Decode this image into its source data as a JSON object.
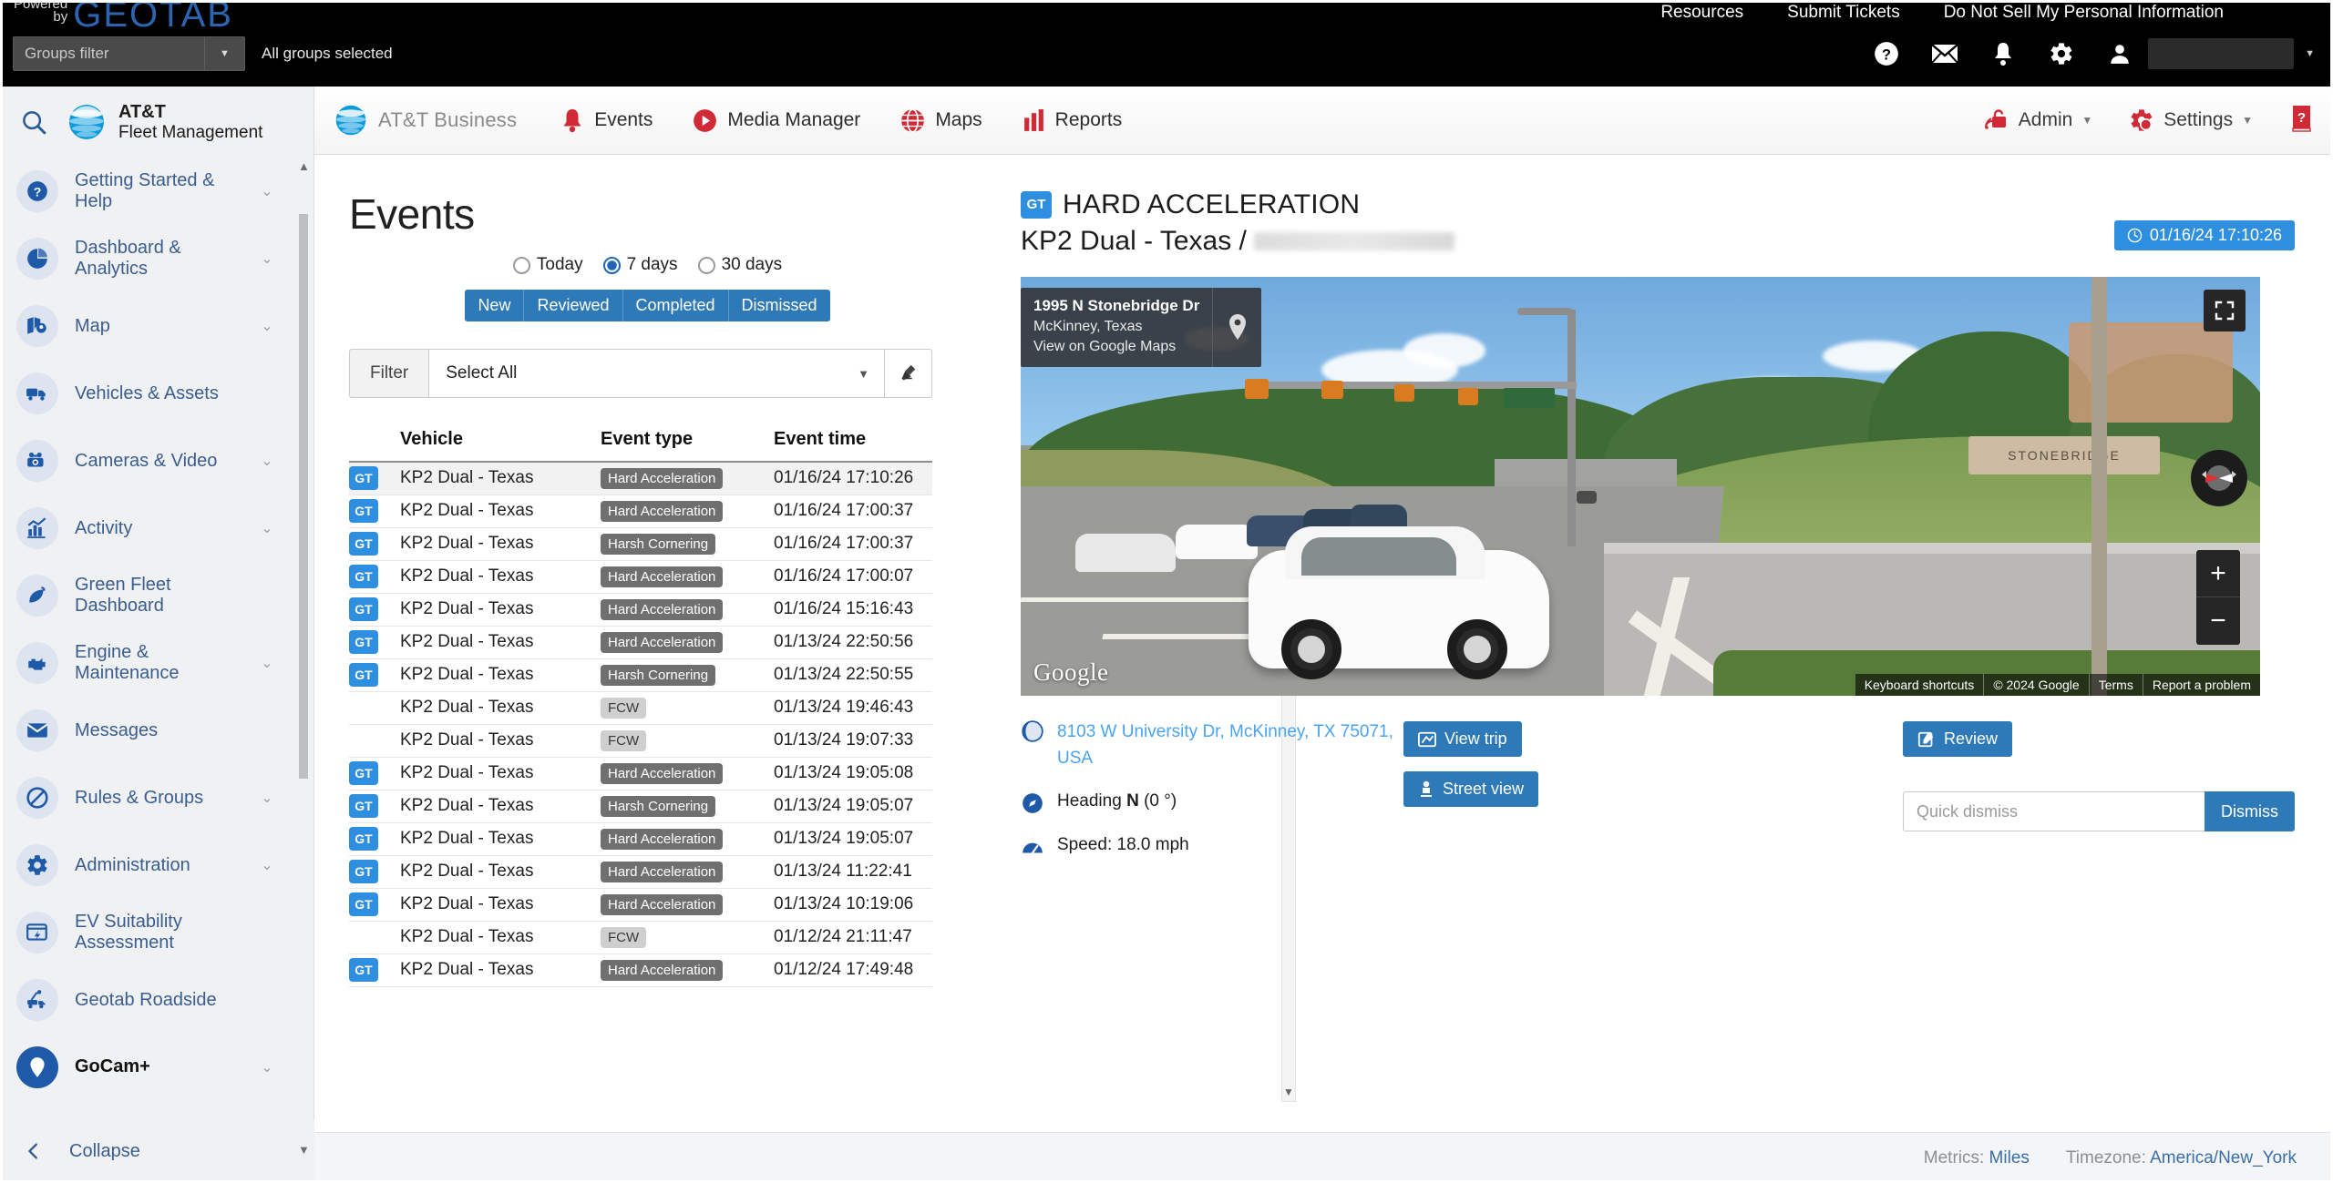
{
  "topbar": {
    "powered_line1": "Powered",
    "powered_line2": "by",
    "brand": "GEOTAB",
    "links": [
      "Resources",
      "Submit Tickets",
      "Do Not Sell My Personal Information"
    ],
    "groups_filter_placeholder": "Groups filter",
    "groups_selected": "All groups selected",
    "icons": [
      "help-icon",
      "mail-icon",
      "bell-icon",
      "gear-icon",
      "user-icon"
    ]
  },
  "sidebar": {
    "brand_line1": "AT&T",
    "brand_line2": "Fleet Management",
    "items": [
      {
        "label": "Getting Started & Help",
        "icon": "question-circle-icon",
        "expandable": true
      },
      {
        "label": "Dashboard & Analytics",
        "icon": "pie-chart-icon",
        "expandable": true
      },
      {
        "label": "Map",
        "icon": "map-pin-icon",
        "expandable": true
      },
      {
        "label": "Vehicles & Assets",
        "icon": "truck-icon",
        "expandable": false
      },
      {
        "label": "Cameras & Video",
        "icon": "dashcam-icon",
        "expandable": true
      },
      {
        "label": "Activity",
        "icon": "bar-chart-icon",
        "expandable": true
      },
      {
        "label": "Green Fleet Dashboard",
        "icon": "leaf-icon",
        "expandable": false
      },
      {
        "label": "Engine & Maintenance",
        "icon": "engine-icon",
        "expandable": true
      },
      {
        "label": "Messages",
        "icon": "envelope-icon",
        "expandable": false
      },
      {
        "label": "Rules & Groups",
        "icon": "no-entry-icon",
        "expandable": true
      },
      {
        "label": "Administration",
        "icon": "gear-icon",
        "expandable": true
      },
      {
        "label": "EV Suitability Assessment",
        "icon": "ev-report-icon",
        "expandable": false
      },
      {
        "label": "Geotab Roadside",
        "icon": "tow-truck-icon",
        "expandable": false
      },
      {
        "label": "GoCam+",
        "icon": "gocam-icon",
        "expandable": true,
        "active": true
      }
    ],
    "collapse_label": "Collapse"
  },
  "appnav": {
    "brand": "AT&T Business",
    "items": [
      {
        "label": "Events",
        "icon": "bell-icon"
      },
      {
        "label": "Media Manager",
        "icon": "play-circle-icon"
      },
      {
        "label": "Maps",
        "icon": "globe-icon"
      },
      {
        "label": "Reports",
        "icon": "bar-chart-icon"
      }
    ],
    "right": [
      {
        "label": "Admin",
        "icon": "admin-lock-icon",
        "caret": true
      },
      {
        "label": "Settings",
        "icon": "gear-wrench-icon",
        "caret": true
      }
    ],
    "help_icon": "help-book-icon"
  },
  "events": {
    "title": "Events",
    "ranges": [
      {
        "label": "Today",
        "selected": false
      },
      {
        "label": "7 days",
        "selected": true
      },
      {
        "label": "30 days",
        "selected": false
      }
    ],
    "status_tabs": [
      "New",
      "Reviewed",
      "Completed",
      "Dismissed"
    ],
    "filter_label": "Filter",
    "filter_value": "Select All",
    "clear_icon": "broom-icon",
    "columns": [
      "",
      "Vehicle",
      "Event type",
      "Event time"
    ],
    "rows": [
      {
        "gt": true,
        "vehicle": "KP2 Dual - Texas",
        "type": "Hard Acceleration",
        "tag": "dark",
        "time": "01/16/24 17:10:26",
        "selected": true
      },
      {
        "gt": true,
        "vehicle": "KP2 Dual - Texas",
        "type": "Hard Acceleration",
        "tag": "dark",
        "time": "01/16/24 17:00:37",
        "selected": false
      },
      {
        "gt": true,
        "vehicle": "KP2 Dual - Texas",
        "type": "Harsh Cornering",
        "tag": "dark",
        "time": "01/16/24 17:00:37",
        "selected": false
      },
      {
        "gt": true,
        "vehicle": "KP2 Dual - Texas",
        "type": "Hard Acceleration",
        "tag": "dark",
        "time": "01/16/24 17:00:07",
        "selected": false
      },
      {
        "gt": true,
        "vehicle": "KP2 Dual - Texas",
        "type": "Hard Acceleration",
        "tag": "dark",
        "time": "01/16/24 15:16:43",
        "selected": false
      },
      {
        "gt": true,
        "vehicle": "KP2 Dual - Texas",
        "type": "Hard Acceleration",
        "tag": "dark",
        "time": "01/13/24 22:50:56",
        "selected": false
      },
      {
        "gt": true,
        "vehicle": "KP2 Dual - Texas",
        "type": "Harsh Cornering",
        "tag": "dark",
        "time": "01/13/24 22:50:55",
        "selected": false
      },
      {
        "gt": false,
        "vehicle": "KP2 Dual - Texas",
        "type": "FCW",
        "tag": "light",
        "time": "01/13/24 19:46:43",
        "selected": false
      },
      {
        "gt": false,
        "vehicle": "KP2 Dual - Texas",
        "type": "FCW",
        "tag": "light",
        "time": "01/13/24 19:07:33",
        "selected": false
      },
      {
        "gt": true,
        "vehicle": "KP2 Dual - Texas",
        "type": "Hard Acceleration",
        "tag": "dark",
        "time": "01/13/24 19:05:08",
        "selected": false
      },
      {
        "gt": true,
        "vehicle": "KP2 Dual - Texas",
        "type": "Harsh Cornering",
        "tag": "dark",
        "time": "01/13/24 19:05:07",
        "selected": false
      },
      {
        "gt": true,
        "vehicle": "KP2 Dual - Texas",
        "type": "Hard Acceleration",
        "tag": "dark",
        "time": "01/13/24 19:05:07",
        "selected": false
      },
      {
        "gt": true,
        "vehicle": "KP2 Dual - Texas",
        "type": "Hard Acceleration",
        "tag": "dark",
        "time": "01/13/24 11:22:41",
        "selected": false
      },
      {
        "gt": true,
        "vehicle": "KP2 Dual - Texas",
        "type": "Hard Acceleration",
        "tag": "dark",
        "time": "01/13/24 10:19:06",
        "selected": false
      },
      {
        "gt": false,
        "vehicle": "KP2 Dual - Texas",
        "type": "FCW",
        "tag": "light",
        "time": "01/12/24 21:11:47",
        "selected": false
      },
      {
        "gt": true,
        "vehicle": "KP2 Dual - Texas",
        "type": "Hard Acceleration",
        "tag": "dark",
        "time": "01/12/24 17:49:48",
        "selected": false
      }
    ]
  },
  "detail": {
    "badge": "GT",
    "event_type": "HARD ACCELERATION",
    "vehicle_line": "KP2 Dual - Texas /",
    "timestamp": "01/16/24 17:10:26",
    "streetview": {
      "address_title": "1995 N Stonebridge Dr",
      "address_city": "McKinney, Texas",
      "view_link": "View on Google Maps",
      "google_wordmark": "Google",
      "sign_text": "STONEBRIDGE",
      "credits": [
        "Keyboard shortcuts",
        "© 2024 Google",
        "Terms",
        "Report a problem"
      ],
      "controls": [
        "fullscreen-icon",
        "compass-icon",
        "zoom-in-icon",
        "zoom-out-icon"
      ]
    },
    "address": "8103 W University Dr, McKinney, TX 75071, USA",
    "heading_label": "Heading",
    "heading_value": "N",
    "heading_degrees": "(0 °)",
    "speed": "Speed: 18.0 mph",
    "buttons": {
      "view_trip": "View trip",
      "street_view": "Street view",
      "review": "Review",
      "dismiss": "Dismiss"
    },
    "quick_dismiss_placeholder": "Quick dismiss"
  },
  "footer": {
    "metrics_label": "Metrics:",
    "metrics_value": "Miles",
    "timezone_label": "Timezone:",
    "timezone_value": "America/New_York"
  },
  "colors": {
    "brand_blue": "#2e7ab8",
    "att_blue": "#2e8fe0",
    "accent_red": "#cf2a36",
    "sidebar_bg": "#f0f1f3"
  }
}
